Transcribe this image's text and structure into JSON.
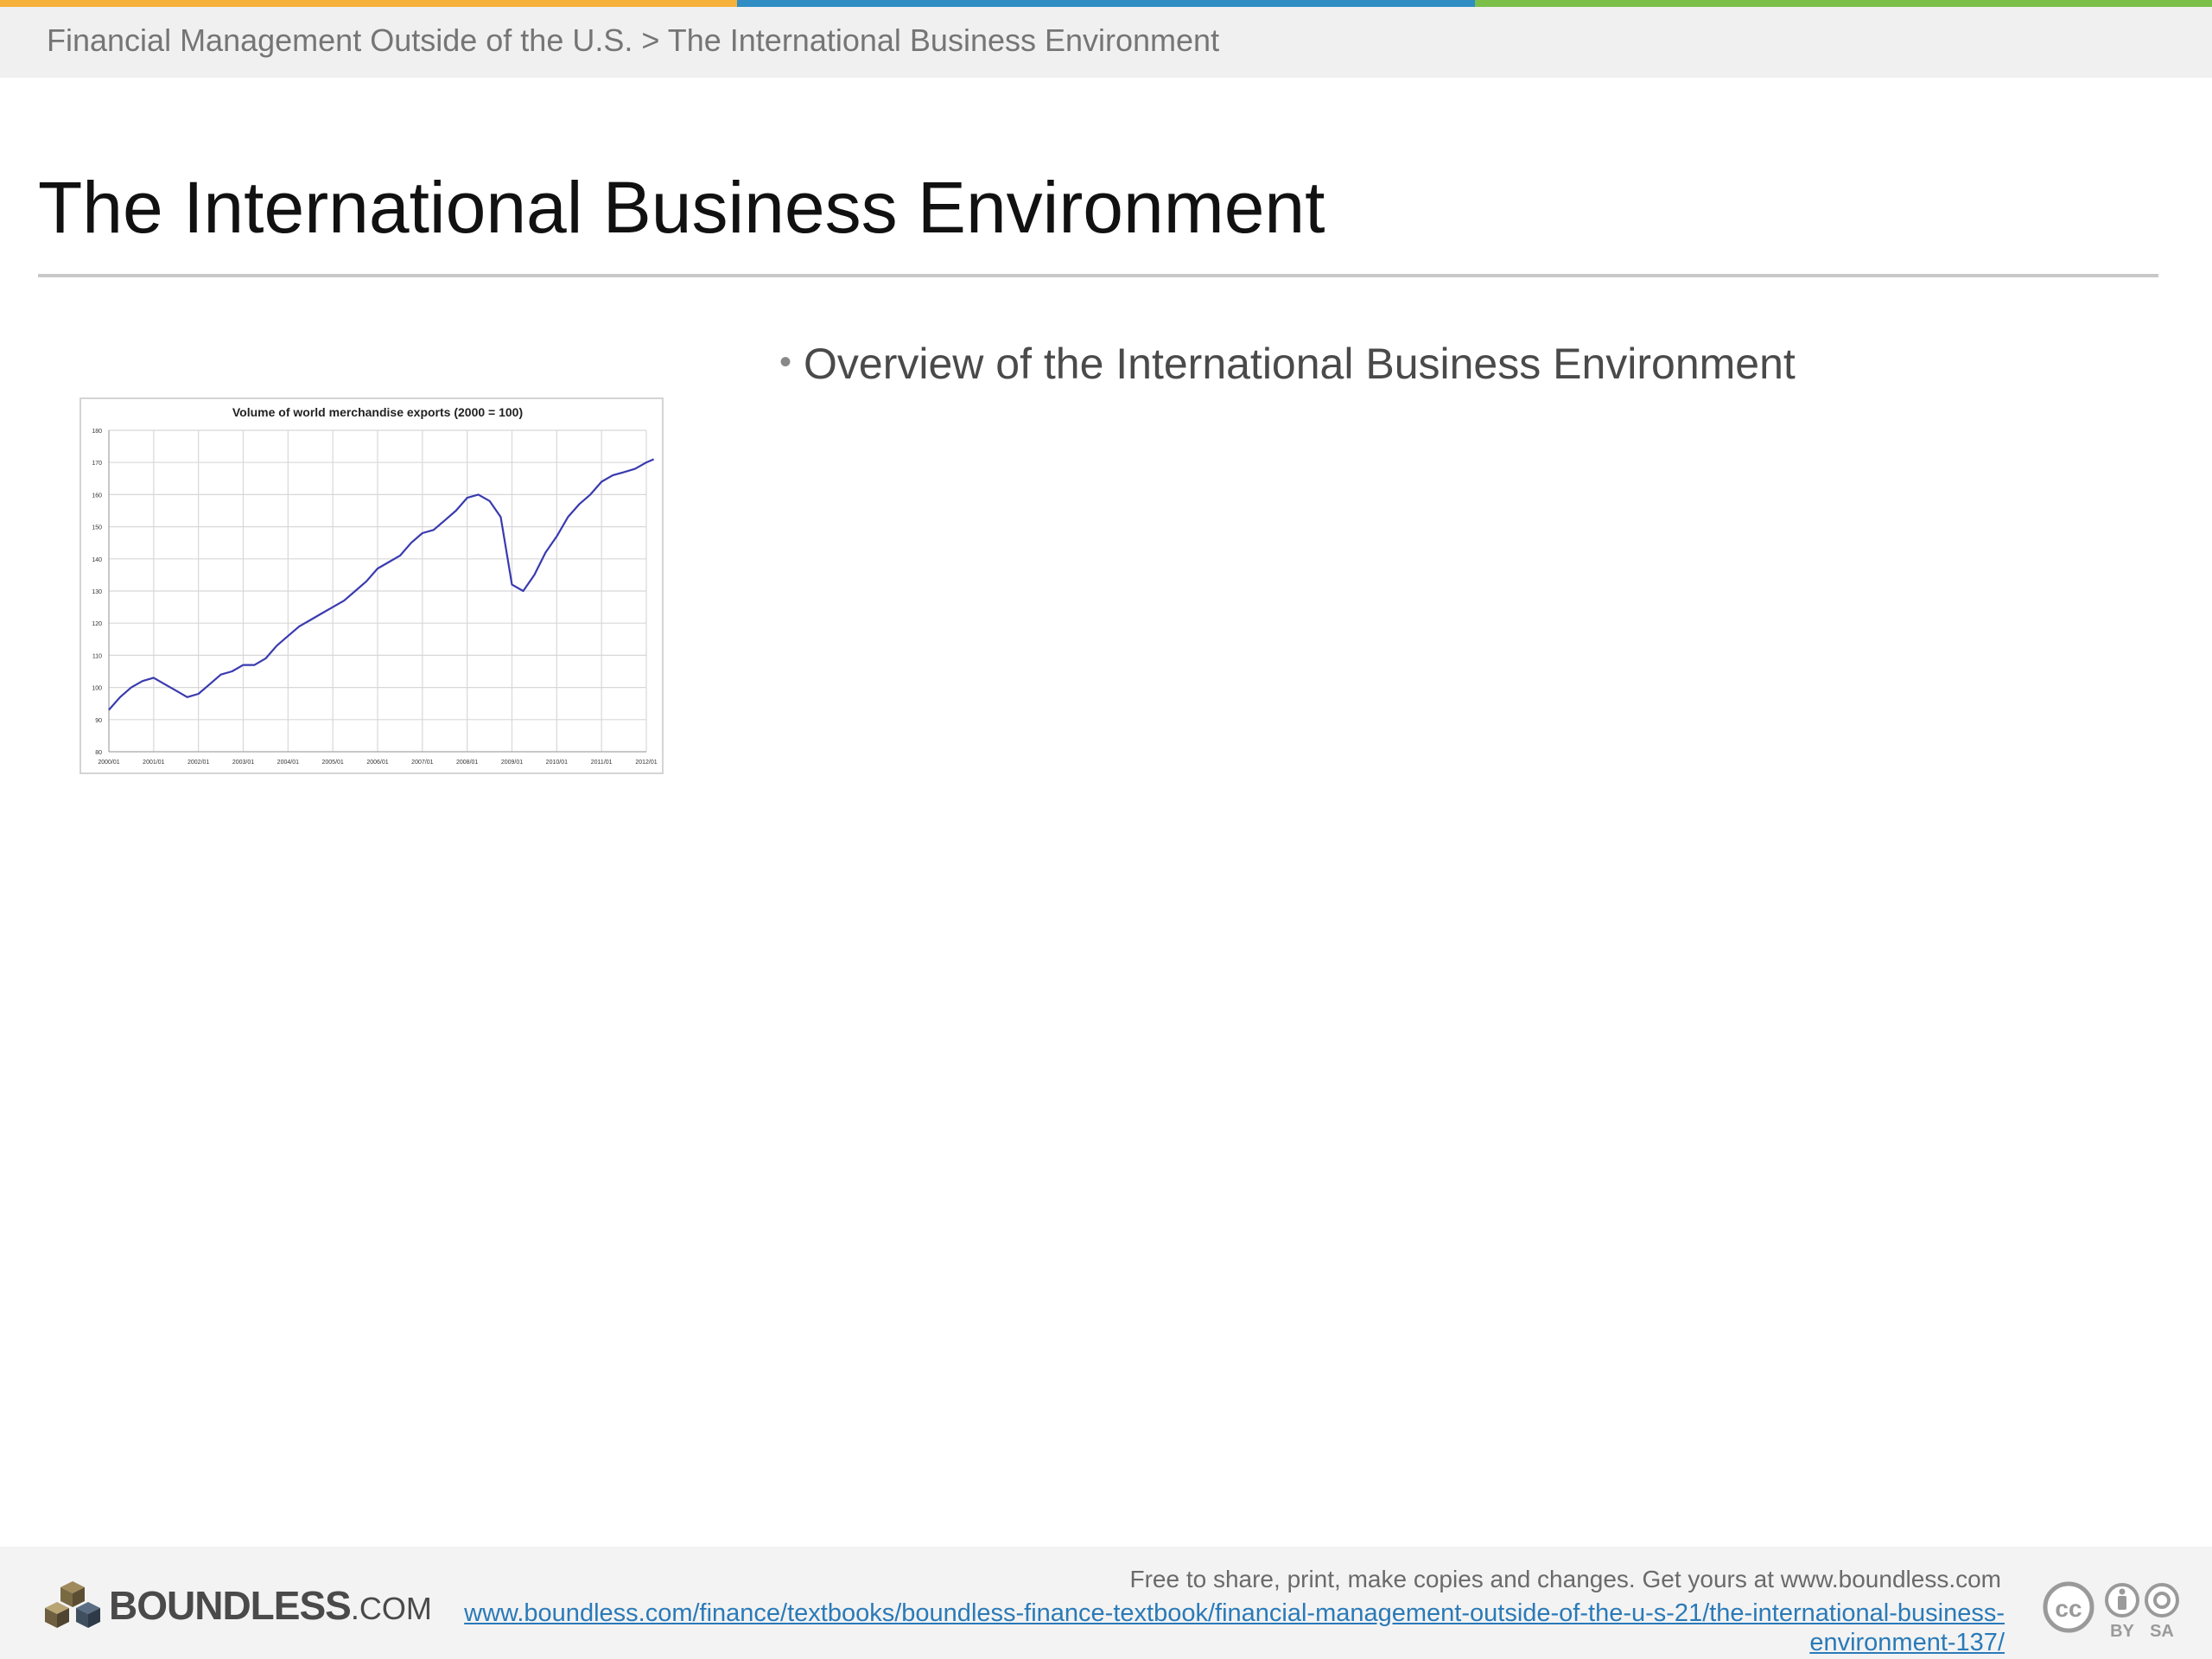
{
  "stripe_colors": [
    "#f6b13a",
    "#2f8dc4",
    "#7bbf48"
  ],
  "breadcrumb": "Financial Management Outside of the U.S. > The International Business Environment",
  "title": "The International Business Environment",
  "bullet": "Overview of the International Business Environment",
  "chart_data": {
    "type": "line",
    "title": "Volume of world merchandise exports (2000 = 100)",
    "x_ticks": [
      "2000/01",
      "2001/01",
      "2002/01",
      "2003/01",
      "2004/01",
      "2005/01",
      "2006/01",
      "2007/01",
      "2008/01",
      "2009/01",
      "2010/01",
      "2011/01",
      "2012/01"
    ],
    "y_ticks": [
      80,
      90,
      100,
      110,
      120,
      130,
      140,
      150,
      160,
      170,
      180
    ],
    "ylim": [
      80,
      180
    ],
    "grid": true,
    "line_color": "#3a3ab0",
    "series": [
      {
        "values": [
          {
            "x": "2000/01",
            "y": 93
          },
          {
            "x": "2000/04",
            "y": 97
          },
          {
            "x": "2000/07",
            "y": 100
          },
          {
            "x": "2000/10",
            "y": 102
          },
          {
            "x": "2001/01",
            "y": 103
          },
          {
            "x": "2001/04",
            "y": 101
          },
          {
            "x": "2001/07",
            "y": 99
          },
          {
            "x": "2001/10",
            "y": 97
          },
          {
            "x": "2002/01",
            "y": 98
          },
          {
            "x": "2002/04",
            "y": 101
          },
          {
            "x": "2002/07",
            "y": 104
          },
          {
            "x": "2002/10",
            "y": 105
          },
          {
            "x": "2003/01",
            "y": 107
          },
          {
            "x": "2003/04",
            "y": 107
          },
          {
            "x": "2003/07",
            "y": 109
          },
          {
            "x": "2003/10",
            "y": 113
          },
          {
            "x": "2004/01",
            "y": 116
          },
          {
            "x": "2004/04",
            "y": 119
          },
          {
            "x": "2004/07",
            "y": 121
          },
          {
            "x": "2004/10",
            "y": 123
          },
          {
            "x": "2005/01",
            "y": 125
          },
          {
            "x": "2005/04",
            "y": 127
          },
          {
            "x": "2005/07",
            "y": 130
          },
          {
            "x": "2005/10",
            "y": 133
          },
          {
            "x": "2006/01",
            "y": 137
          },
          {
            "x": "2006/04",
            "y": 139
          },
          {
            "x": "2006/07",
            "y": 141
          },
          {
            "x": "2006/10",
            "y": 145
          },
          {
            "x": "2007/01",
            "y": 148
          },
          {
            "x": "2007/04",
            "y": 149
          },
          {
            "x": "2007/07",
            "y": 152
          },
          {
            "x": "2007/10",
            "y": 155
          },
          {
            "x": "2008/01",
            "y": 159
          },
          {
            "x": "2008/04",
            "y": 160
          },
          {
            "x": "2008/07",
            "y": 158
          },
          {
            "x": "2008/10",
            "y": 153
          },
          {
            "x": "2009/01",
            "y": 132
          },
          {
            "x": "2009/04",
            "y": 130
          },
          {
            "x": "2009/07",
            "y": 135
          },
          {
            "x": "2009/10",
            "y": 142
          },
          {
            "x": "2010/01",
            "y": 147
          },
          {
            "x": "2010/04",
            "y": 153
          },
          {
            "x": "2010/07",
            "y": 157
          },
          {
            "x": "2010/10",
            "y": 160
          },
          {
            "x": "2011/01",
            "y": 164
          },
          {
            "x": "2011/04",
            "y": 166
          },
          {
            "x": "2011/07",
            "y": 167
          },
          {
            "x": "2011/10",
            "y": 168
          },
          {
            "x": "2012/01",
            "y": 170
          },
          {
            "x": "2012/03",
            "y": 171
          }
        ]
      }
    ]
  },
  "footer": {
    "logo_text": "BOUNDLESS",
    "logo_suffix": ".COM",
    "free_text": "Free to share, print, make copies and changes. Get yours at www.boundless.com",
    "url": "www.boundless.com/finance/textbooks/boundless-finance-textbook/financial-management-outside-of-the-u-s-21/the-international-business-environment-137/",
    "cc_badges": [
      "BY",
      "SA"
    ]
  }
}
